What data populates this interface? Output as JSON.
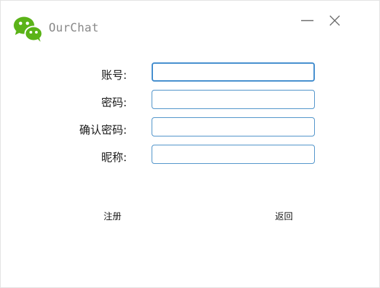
{
  "app": {
    "title": "OurChat",
    "logo_icon": "wechat-logo-icon",
    "brand_color": "#5bb318"
  },
  "window_controls": {
    "minimize_icon": "minimize-icon",
    "close_icon": "close-icon"
  },
  "form": {
    "fields": [
      {
        "label": "账号:",
        "value": ""
      },
      {
        "label": "密码:",
        "value": ""
      },
      {
        "label": "确认密码:",
        "value": ""
      },
      {
        "label": "昵称:",
        "value": ""
      }
    ],
    "input_border_color": "#4a90c8"
  },
  "actions": {
    "register_label": "注册",
    "back_label": "返回"
  }
}
